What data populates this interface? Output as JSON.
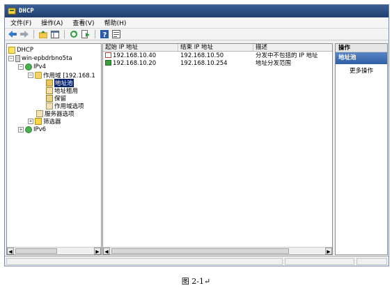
{
  "window": {
    "title": "DHCP"
  },
  "menu": {
    "file": "文件(F)",
    "action": "操作(A)",
    "view": "查看(V)",
    "help": "帮助(H)"
  },
  "toolbar": {
    "icons": [
      "back-arrow",
      "forward-arrow",
      "up-folder",
      "show-hide-tree",
      "refresh",
      "export-list",
      "help",
      "properties"
    ]
  },
  "tree": {
    "root": "DHCP",
    "server": "win-epbdrbno5ta",
    "ipv4": "IPv4",
    "scope": "作用域 [192.168.1",
    "pool": "地址池",
    "leases": "地址租用",
    "reservations": "保留",
    "scope_options": "作用域选项",
    "server_options": "服务器选项",
    "filters": "筛选器",
    "ipv6": "IPv6"
  },
  "list": {
    "columns": [
      "起始 IP 地址",
      "结束 IP 地址",
      "描述"
    ],
    "rows": [
      {
        "start": "192.168.10.40",
        "end": "192.168.10.50",
        "desc": "分发中不包括的 IP 地址",
        "kind": "exclusion"
      },
      {
        "start": "192.168.10.20",
        "end": "192.168.10.254",
        "desc": "地址分发范围",
        "kind": "range"
      }
    ]
  },
  "actions": {
    "header": "操作",
    "group": "地址池",
    "more": "更多操作"
  },
  "caption": {
    "text": "图 2-1↵"
  },
  "colors": {
    "selection": "#0a246a",
    "titlebar": "#1f3f6e",
    "action_group": "#2f5fa6"
  }
}
